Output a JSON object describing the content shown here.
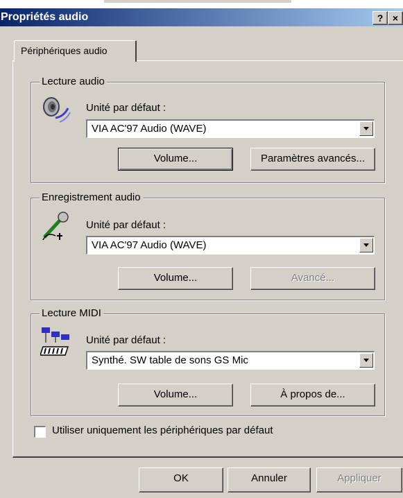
{
  "window": {
    "title": "Propriétés audio",
    "help_glyph": "?",
    "close_glyph": "×"
  },
  "tabs": [
    {
      "label": "Périphériques audio",
      "active": true
    }
  ],
  "playback": {
    "legend": "Lecture audio",
    "default_label": "Unité par défaut :",
    "device": "VIA AC'97 Audio (WAVE)",
    "volume_button": "Volume...",
    "advanced_button": "Paramètres avancés...",
    "icon": "speaker-icon"
  },
  "recording": {
    "legend": "Enregistrement audio",
    "default_label": "Unité par défaut :",
    "device": "VIA AC'97 Audio (WAVE)",
    "volume_button": "Volume...",
    "advanced_button": "Avancé...",
    "icon": "microphone-icon"
  },
  "midi": {
    "legend": "Lecture MIDI",
    "default_label": "Unité par défaut :",
    "device": "Synthé. SW table de sons GS Mic",
    "volume_button": "Volume...",
    "about_button": "À propos de...",
    "icon": "midi-keyboard-icon"
  },
  "options": {
    "use_default_only": "Utiliser uniquement les périphériques par défaut",
    "use_default_only_checked": false
  },
  "footer": {
    "ok": "OK",
    "cancel": "Annuler",
    "apply": "Appliquer"
  },
  "colors": {
    "titlebar_start": "#0a246a",
    "titlebar_end": "#a6caf0",
    "face": "#d4d0c8"
  }
}
